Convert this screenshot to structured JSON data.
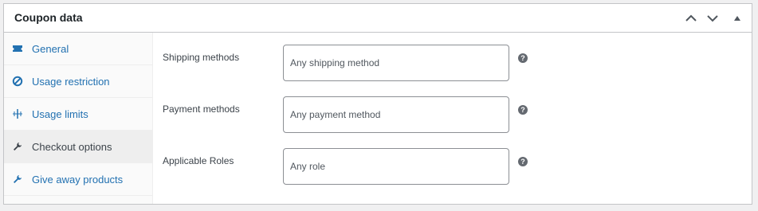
{
  "panel": {
    "title": "Coupon data",
    "controls": [
      {
        "name": "move-up",
        "icon": "chevron-up-icon"
      },
      {
        "name": "move-down",
        "icon": "chevron-down-icon"
      },
      {
        "name": "toggle-panel",
        "icon": "triangle-up-icon"
      }
    ]
  },
  "sidebar": {
    "items": [
      {
        "label": "General",
        "icon": "ticket-icon",
        "active": false
      },
      {
        "label": "Usage restriction",
        "icon": "block-icon",
        "active": false
      },
      {
        "label": "Usage limits",
        "icon": "limits-icon",
        "active": false
      },
      {
        "label": "Checkout options",
        "icon": "wrench-icon",
        "active": true
      },
      {
        "label": "Give away products",
        "icon": "wrench-icon",
        "active": false
      }
    ]
  },
  "fields": [
    {
      "label": "Shipping methods",
      "placeholder": "Any shipping method",
      "help": "?"
    },
    {
      "label": "Payment methods",
      "placeholder": "Any payment method",
      "help": "?"
    },
    {
      "label": "Applicable Roles",
      "placeholder": "Any role",
      "help": "?"
    }
  ],
  "colors": {
    "link": "#2271b1",
    "active_text": "#3c434a",
    "border": "#c3c4c7",
    "background": "#f0f0f1"
  }
}
